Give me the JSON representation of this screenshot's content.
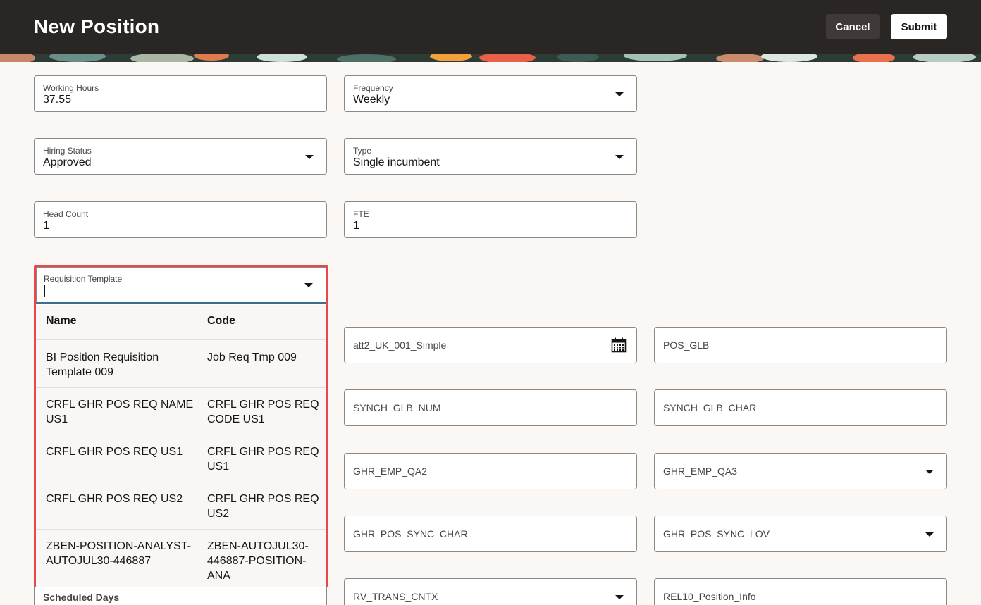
{
  "header": {
    "title": "New Position",
    "cancel_label": "Cancel",
    "submit_label": "Submit"
  },
  "fields": {
    "working_hours": {
      "label": "Working Hours",
      "value": "37.55"
    },
    "frequency": {
      "label": "Frequency",
      "value": "Weekly"
    },
    "hiring_status": {
      "label": "Hiring Status",
      "value": "Approved"
    },
    "type": {
      "label": "Type",
      "value": "Single incumbent"
    },
    "head_count": {
      "label": "Head Count",
      "value": "1"
    },
    "fte": {
      "label": "FTE",
      "value": "1"
    },
    "scheduled_days": {
      "label": "Scheduled Days"
    }
  },
  "requisition": {
    "label": "Requisition Template",
    "columns": {
      "name": "Name",
      "code": "Code"
    },
    "rows": [
      {
        "name": "BI Position Requisition Template 009",
        "code": "Job Req Tmp 009"
      },
      {
        "name": "CRFL GHR POS REQ NAME US1",
        "code": "CRFL GHR POS REQ CODE US1"
      },
      {
        "name": "CRFL GHR POS REQ US1",
        "code": "CRFL GHR POS REQ US1"
      },
      {
        "name": "CRFL GHR POS REQ US2",
        "code": "CRFL GHR POS REQ US2"
      },
      {
        "name": "ZBEN-POSITION-ANALYST-AUTOJUL30-446887",
        "code": "ZBEN-AUTOJUL30-446887-POSITION-ANA"
      }
    ]
  },
  "flex_fields": {
    "att2": "att2_UK_001_Simple",
    "pos_glb": "POS_GLB",
    "synch_glb_num": "SYNCH_GLB_NUM",
    "synch_glb_char": "SYNCH_GLB_CHAR",
    "ghr_emp_qa2": "GHR_EMP_QA2",
    "ghr_emp_qa3": "GHR_EMP_QA3",
    "ghr_pos_sync_char": "GHR_POS_SYNC_CHAR",
    "ghr_pos_sync_lov": "GHR_POS_SYNC_LOV",
    "rv_trans_cntx": "RV_TRANS_CNTX",
    "rel10_position_info": "REL10_Position_Info"
  },
  "colors": {
    "header_bg": "#2a2624",
    "page_bg": "#faf7f4",
    "highlight": "#e8484a",
    "focus": "#3a6f8f"
  },
  "icons": {
    "dropdown": "caret-down-icon",
    "calendar": "calendar-icon"
  }
}
